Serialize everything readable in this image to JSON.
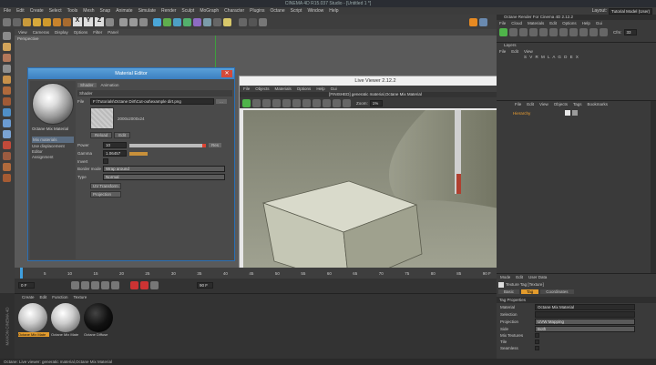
{
  "window_title": "CINEMA 4D R15.037 Studio - [Untitled 1 *]",
  "main_menu": [
    "File",
    "Edit",
    "Create",
    "Select",
    "Tools",
    "Mesh",
    "Snap",
    "Animate",
    "Simulate",
    "Render",
    "Sculpt",
    "MoGraph",
    "Character",
    "Plugins",
    "Octane",
    "Script",
    "Window",
    "Help"
  ],
  "layout_label": "Layout:",
  "layout_value": "Tutorial Model (User)",
  "axis_buttons": [
    "X",
    "Y",
    "Z"
  ],
  "viewport": {
    "menu": [
      "View",
      "Cameras",
      "Display",
      "Options",
      "Filter",
      "Panel"
    ],
    "label": "Perspective"
  },
  "material_editor": {
    "title": "Material Editor",
    "tabs": [
      "Shader",
      "Animation"
    ],
    "section": "Shader",
    "file_label": "File",
    "file_path": "F:\\Tutorials\\Octane Dirt\\Cut-out\\example dirt.png",
    "file_button": "...",
    "preview_size": "2000x2000x24",
    "reload_button": "Reload",
    "edit_button": "Edit",
    "material_name": "Octane Mix Material",
    "channels": [
      "Mix materials",
      "Use displacement",
      "Editor",
      "Assignment"
    ],
    "params": [
      {
        "label": "Power",
        "value": "10"
      },
      {
        "label": "Gamma",
        "value": "1.06457"
      },
      {
        "label": "Invert",
        "value": ""
      },
      {
        "label": "Border mode",
        "value": "Wrap around"
      },
      {
        "label": "Type",
        "value": "Normal"
      }
    ],
    "reset_label": "Res",
    "uv_transform_button": "UV Transform",
    "projection_button": "Projection"
  },
  "live_viewer": {
    "title": "Live Viewer 2.12.2",
    "menu": [
      "File",
      "Objects",
      "Materials",
      "Options",
      "Help",
      "Gui"
    ],
    "status": "[FINISHED] generatic material,Octane Mix Material",
    "zoom_label": "Zoom:",
    "zoom_value": "1%"
  },
  "octane_panel": {
    "title": "Octane Render For Cinema 4D 2.12.2",
    "menu": [
      "File",
      "Cloud",
      "Materials",
      "Edit",
      "Options",
      "Help",
      "Gui"
    ],
    "pixels_label": "Cfm:",
    "pixels_value": "33"
  },
  "layers_panel": {
    "title": "Layers",
    "menu": [
      "File",
      "Edit",
      "View"
    ],
    "columns": "S V R M L A G D E X"
  },
  "objects_panel": {
    "menu": [
      "File",
      "Edit",
      "View",
      "Objects",
      "Tags",
      "Bookmarks"
    ],
    "item": "Hierarchy"
  },
  "timeline": {
    "ticks": [
      "0",
      "5",
      "10",
      "15",
      "20",
      "25",
      "30",
      "35",
      "40",
      "45",
      "50",
      "55",
      "60",
      "65",
      "70",
      "75",
      "80",
      "85",
      "90 F"
    ],
    "frame_start": "0 F",
    "frame_end": "90 F"
  },
  "material_manager": {
    "menu": [
      "Create",
      "Edit",
      "Function",
      "Texture"
    ],
    "materials": [
      "Octane Mix Mate",
      "Octane Mix Mate",
      "Octane Diffuse"
    ]
  },
  "attributes": {
    "menu": [
      "Mode",
      "Edit",
      "User Data"
    ],
    "tag_name": "Texture Tag [Texture]",
    "tabs": [
      "Basic",
      "Tag",
      "Coordinates"
    ],
    "section": "Tag Properties",
    "rows": [
      {
        "label": "Material",
        "value": "Octane Mix Material"
      },
      {
        "label": "Selection",
        "value": ""
      },
      {
        "label": "Projection",
        "value": "UVW Mapping"
      },
      {
        "label": "Side",
        "value": "Both"
      },
      {
        "label": "Mix Textures",
        "value": ""
      },
      {
        "label": "Tile",
        "value": ""
      },
      {
        "label": "Seamless",
        "value": ""
      }
    ]
  },
  "status_bar": "Octane: Live viewer: generatic material,Octane Mix Material",
  "brand": "MAXON CINEMA 4D"
}
